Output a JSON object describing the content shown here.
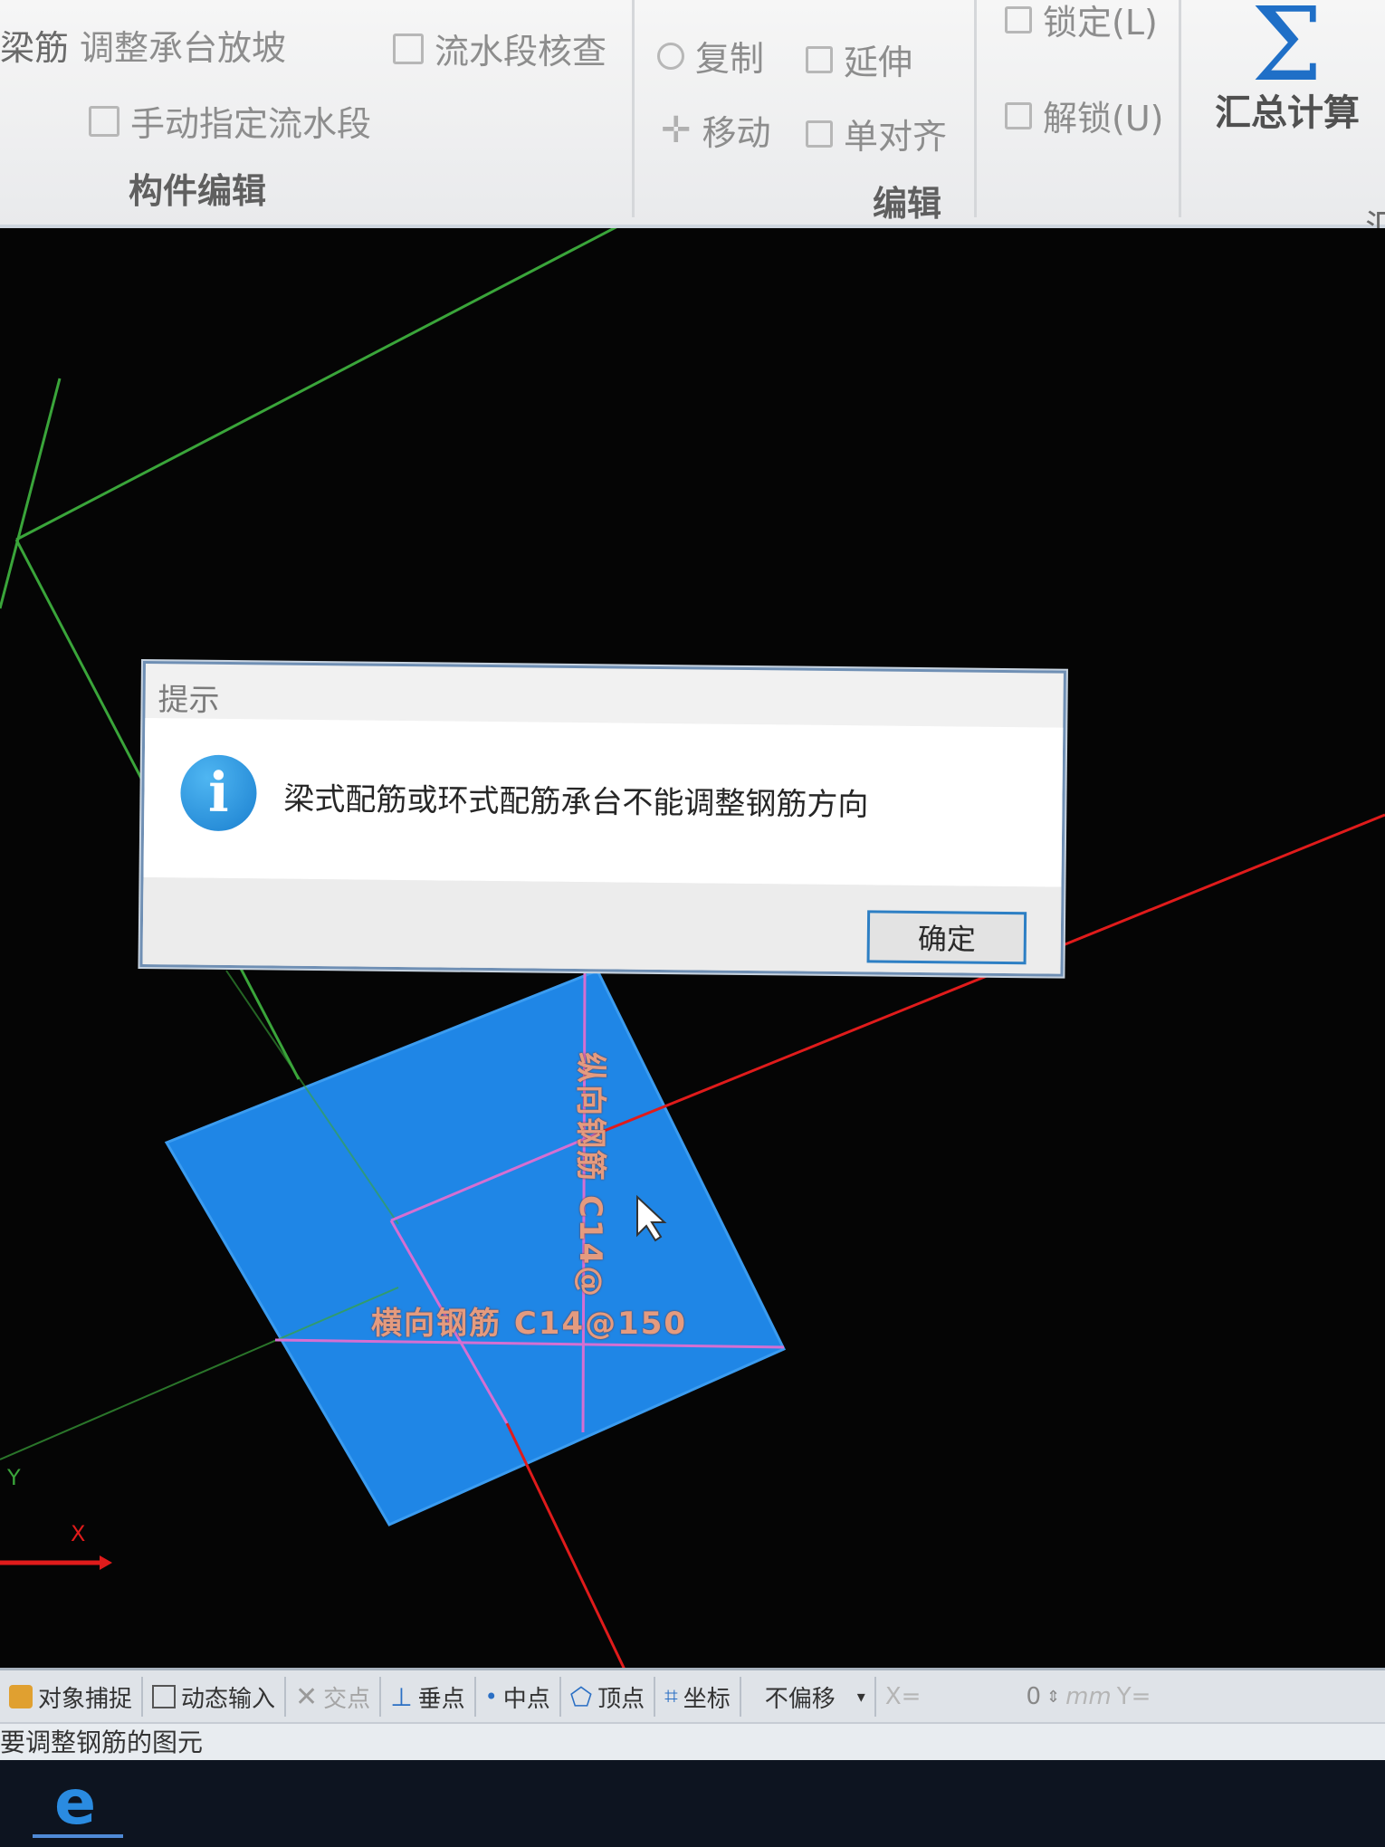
{
  "ribbon": {
    "component_edit": {
      "partial_left": "梁筋",
      "adjust_slope": "调整承台放坡",
      "flow_check": "流水段核查",
      "manual_flow": "手动指定流水段",
      "group_label": "构件编辑"
    },
    "edit": {
      "copy": "复制",
      "extend": "延伸",
      "move": "移动",
      "align": "单对齐",
      "group_label": "编辑"
    },
    "lock": {
      "lock": "锁定(L)",
      "unlock": "解锁(U)"
    },
    "sum": {
      "label": "汇总计算",
      "partial_group": "汇"
    }
  },
  "canvas": {
    "slab_labels": {
      "vertical": "纵向钢筋 C14@",
      "horizontal": "横向钢筋 C14@150"
    },
    "axis": {
      "y": "Y",
      "x": "X"
    }
  },
  "dialog": {
    "title": "提示",
    "icon": "info-icon",
    "message": "梁式配筋或环式配筋承台不能调整钢筋方向",
    "ok_label": "确定"
  },
  "statusbar": {
    "items": [
      {
        "label": "对象捕捉",
        "icon": "snap-icon"
      },
      {
        "label": "动态输入",
        "icon": "dynamic-input-icon"
      },
      {
        "label": "交点",
        "icon": "intersection-icon"
      },
      {
        "label": "垂点",
        "icon": "perpendicular-icon"
      },
      {
        "label": "中点",
        "icon": "midpoint-icon"
      },
      {
        "label": "顶点",
        "icon": "vertex-icon"
      },
      {
        "label": "坐标",
        "icon": "coordinate-icon"
      }
    ],
    "offset_mode": "不偏移",
    "x_label": "X=",
    "x_value": "0",
    "unit": "mm",
    "y_label": "Y="
  },
  "status_line": "要调整钢筋的图元",
  "colors": {
    "ribbon_bg": "#efefef",
    "canvas_bg": "#050505",
    "slab_fill": "#1f86e6",
    "axis_x": "#e01b1b",
    "axis_y": "#3aa53a",
    "rebar_line": "#d56fd2",
    "accent": "#1f6fc7"
  }
}
